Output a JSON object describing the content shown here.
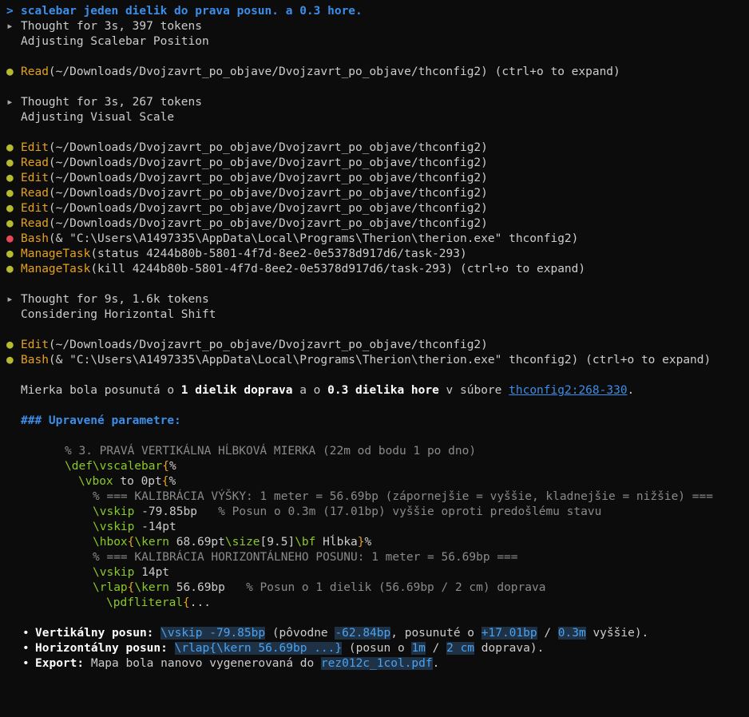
{
  "prompt": {
    "caret": ">",
    "text": "scalebar jeden dielik do prava posun. a 0.3 hore."
  },
  "think1": {
    "summary": "Thought for 3s, 397 tokens",
    "detail": "Adjusting Scalebar Position"
  },
  "read1": {
    "tool": "Read",
    "args": "(~/Downloads/Dvojzavrt_po_objave/Dvojzavrt_po_objave/thconfig2) (ctrl+o to expand)"
  },
  "think2": {
    "summary": "Thought for 3s, 267 tokens",
    "detail": "Adjusting Visual Scale"
  },
  "calls1": [
    {
      "tool": "Edit",
      "args": "(~/Downloads/Dvojzavrt_po_objave/Dvojzavrt_po_objave/thconfig2)"
    },
    {
      "tool": "Read",
      "args": "(~/Downloads/Dvojzavrt_po_objave/Dvojzavrt_po_objave/thconfig2)"
    },
    {
      "tool": "Edit",
      "args": "(~/Downloads/Dvojzavrt_po_objave/Dvojzavrt_po_objave/thconfig2)"
    },
    {
      "tool": "Read",
      "args": "(~/Downloads/Dvojzavrt_po_objave/Dvojzavrt_po_objave/thconfig2)"
    },
    {
      "tool": "Edit",
      "args": "(~/Downloads/Dvojzavrt_po_objave/Dvojzavrt_po_objave/thconfig2)"
    },
    {
      "tool": "Read",
      "args": "(~/Downloads/Dvojzavrt_po_objave/Dvojzavrt_po_objave/thconfig2)"
    }
  ],
  "bash1": {
    "tool": "Bash",
    "args": "(& \"C:\\Users\\A1497335\\AppData\\Local\\Programs\\Therion\\therion.exe\" thconfig2)"
  },
  "mt1": {
    "tool": "ManageTask",
    "args": "(status 4244b80b-5801-4f7d-8ee2-0e5378d917d6/task-293)"
  },
  "mt2": {
    "tool": "ManageTask",
    "args": "(kill 4244b80b-5801-4f7d-8ee2-0e5378d917d6/task-293) (ctrl+o to expand)"
  },
  "think3": {
    "summary": "Thought for 9s, 1.6k tokens",
    "detail": "Considering Horizontal Shift"
  },
  "edit_last": {
    "tool": "Edit",
    "args": "(~/Downloads/Dvojzavrt_po_objave/Dvojzavrt_po_objave/thconfig2)"
  },
  "bash2": {
    "tool": "Bash",
    "args": "(& \"C:\\Users\\A1497335\\AppData\\Local\\Programs\\Therion\\therion.exe\" thconfig2) (ctrl+o to expand)"
  },
  "summary": {
    "t1": "Mierka bola posunutá o ",
    "b1": "1 dielik doprava",
    "t2": " a o ",
    "b2": "0.3 dielika hore",
    "t3": " v súbore ",
    "link": "thconfig2:268-330",
    "t4": "."
  },
  "heading": "### Upravené parametre:",
  "code": {
    "l1": "% 3. PRAVÁ VERTIKÁLNA HĹBKOVÁ MIERKA (22m od bodu 1 po dno)",
    "l2_kw": "\\def\\vscalebar",
    "l2_br": "{",
    "l2_rest": "%",
    "l3_kw": "\\vbox",
    "l3_rest": " to 0pt",
    "l3_br": "{",
    "l3_end": "%",
    "l4": "% === KALIBRÁCIA VÝŠKY: 1 meter = 56.69bp (zápornejšie = vyššie, kladnejšie = nižšie) ===",
    "l5_kw": "\\vskip",
    "l5_val": " -79.85bp",
    "l5_cm": "   % Posun o 0.3m (17.01bp) vyššie oproti predošlému stavu",
    "l6_kw": "\\vskip",
    "l6_val": " -14pt",
    "l7_kw1": "\\hbox",
    "l7_br1": "{",
    "l7_kw2": "\\kern",
    "l7_t1": " 68.69pt",
    "l7_kw3": "\\size",
    "l7_t2": "[9.5]",
    "l7_kw4": "\\bf",
    "l7_t3": " Hĺbka",
    "l7_br2": "}",
    "l7_t4": "%",
    "l8": "% === KALIBRÁCIA HORIZONTÁLNEHO POSUNU: 1 meter = 56.69bp ===",
    "l9_kw": "\\vskip",
    "l9_val": " 14pt",
    "l10_kw1": "\\rlap",
    "l10_br": "{",
    "l10_kw2": "\\kern",
    "l10_val": " 56.69bp",
    "l10_cm": "   % Posun o 1 dielik (56.69bp / 2 cm) doprava",
    "l11_kw": "\\pdfliteral",
    "l11_br": "{",
    "l11_rest": "..."
  },
  "bullets": [
    {
      "label": "Vertikálny posun:",
      "parts": [
        " ",
        "\\vskip -79.85bp",
        " (pôvodne ",
        "-62.84bp",
        ", posunuté o ",
        "+17.01bp",
        " / ",
        "0.3m",
        " vyššie)."
      ]
    },
    {
      "label": "Horizontálny posun:",
      "parts": [
        " ",
        "\\rlap{\\kern 56.69bp ...}",
        " (posun o ",
        "1m",
        " / ",
        "2 cm",
        " doprava)."
      ]
    },
    {
      "label": "Export:",
      "parts": [
        " Mapa bola nanovo vygenerovaná do ",
        "rez012c_1col.pdf",
        "."
      ]
    }
  ],
  "colors": {
    "background": "#0c0c0c",
    "prompt": "#3b8eea",
    "tool": "#e5a11e",
    "dot_ok": "#b5ba2f",
    "dot_err": "#e74856",
    "keyword": "#8ac926",
    "comment": "#8a8a8a",
    "chip_bg": "#1f3145"
  },
  "icons": {
    "thought": "triangle-right-icon",
    "tool_status": "bullet-dot-icon"
  }
}
